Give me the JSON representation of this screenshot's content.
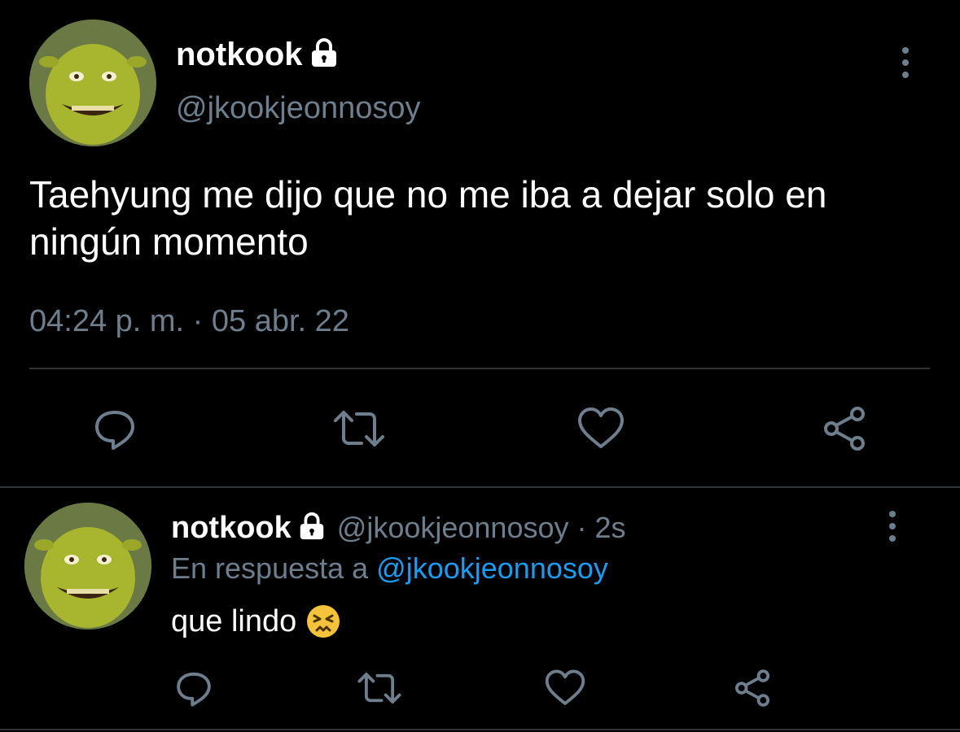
{
  "main_tweet": {
    "display_name": "notkook",
    "handle": "@jkookjeonnosoy",
    "text": "Taehyung me dijo que no me iba a dejar solo en ningún momento",
    "timestamp": "04:24 p. m. · 05 abr. 22"
  },
  "reply": {
    "display_name": "notkook",
    "handle_time": "@jkookjeonnosoy · 2s",
    "reply_prefix": "En respuesta a ",
    "reply_to": "@jkookjeonnosoy",
    "text": "que lindo ",
    "emoji": "😣"
  },
  "icons": {
    "lock": "lock-icon",
    "more": "more-vertical-icon",
    "reply": "comment-icon",
    "retweet": "retweet-icon",
    "like": "heart-icon",
    "share": "share-icon"
  },
  "colors": {
    "background": "#000000",
    "muted": "#6e7e8c",
    "link": "#1d9bf0",
    "divider": "#2f3336"
  }
}
